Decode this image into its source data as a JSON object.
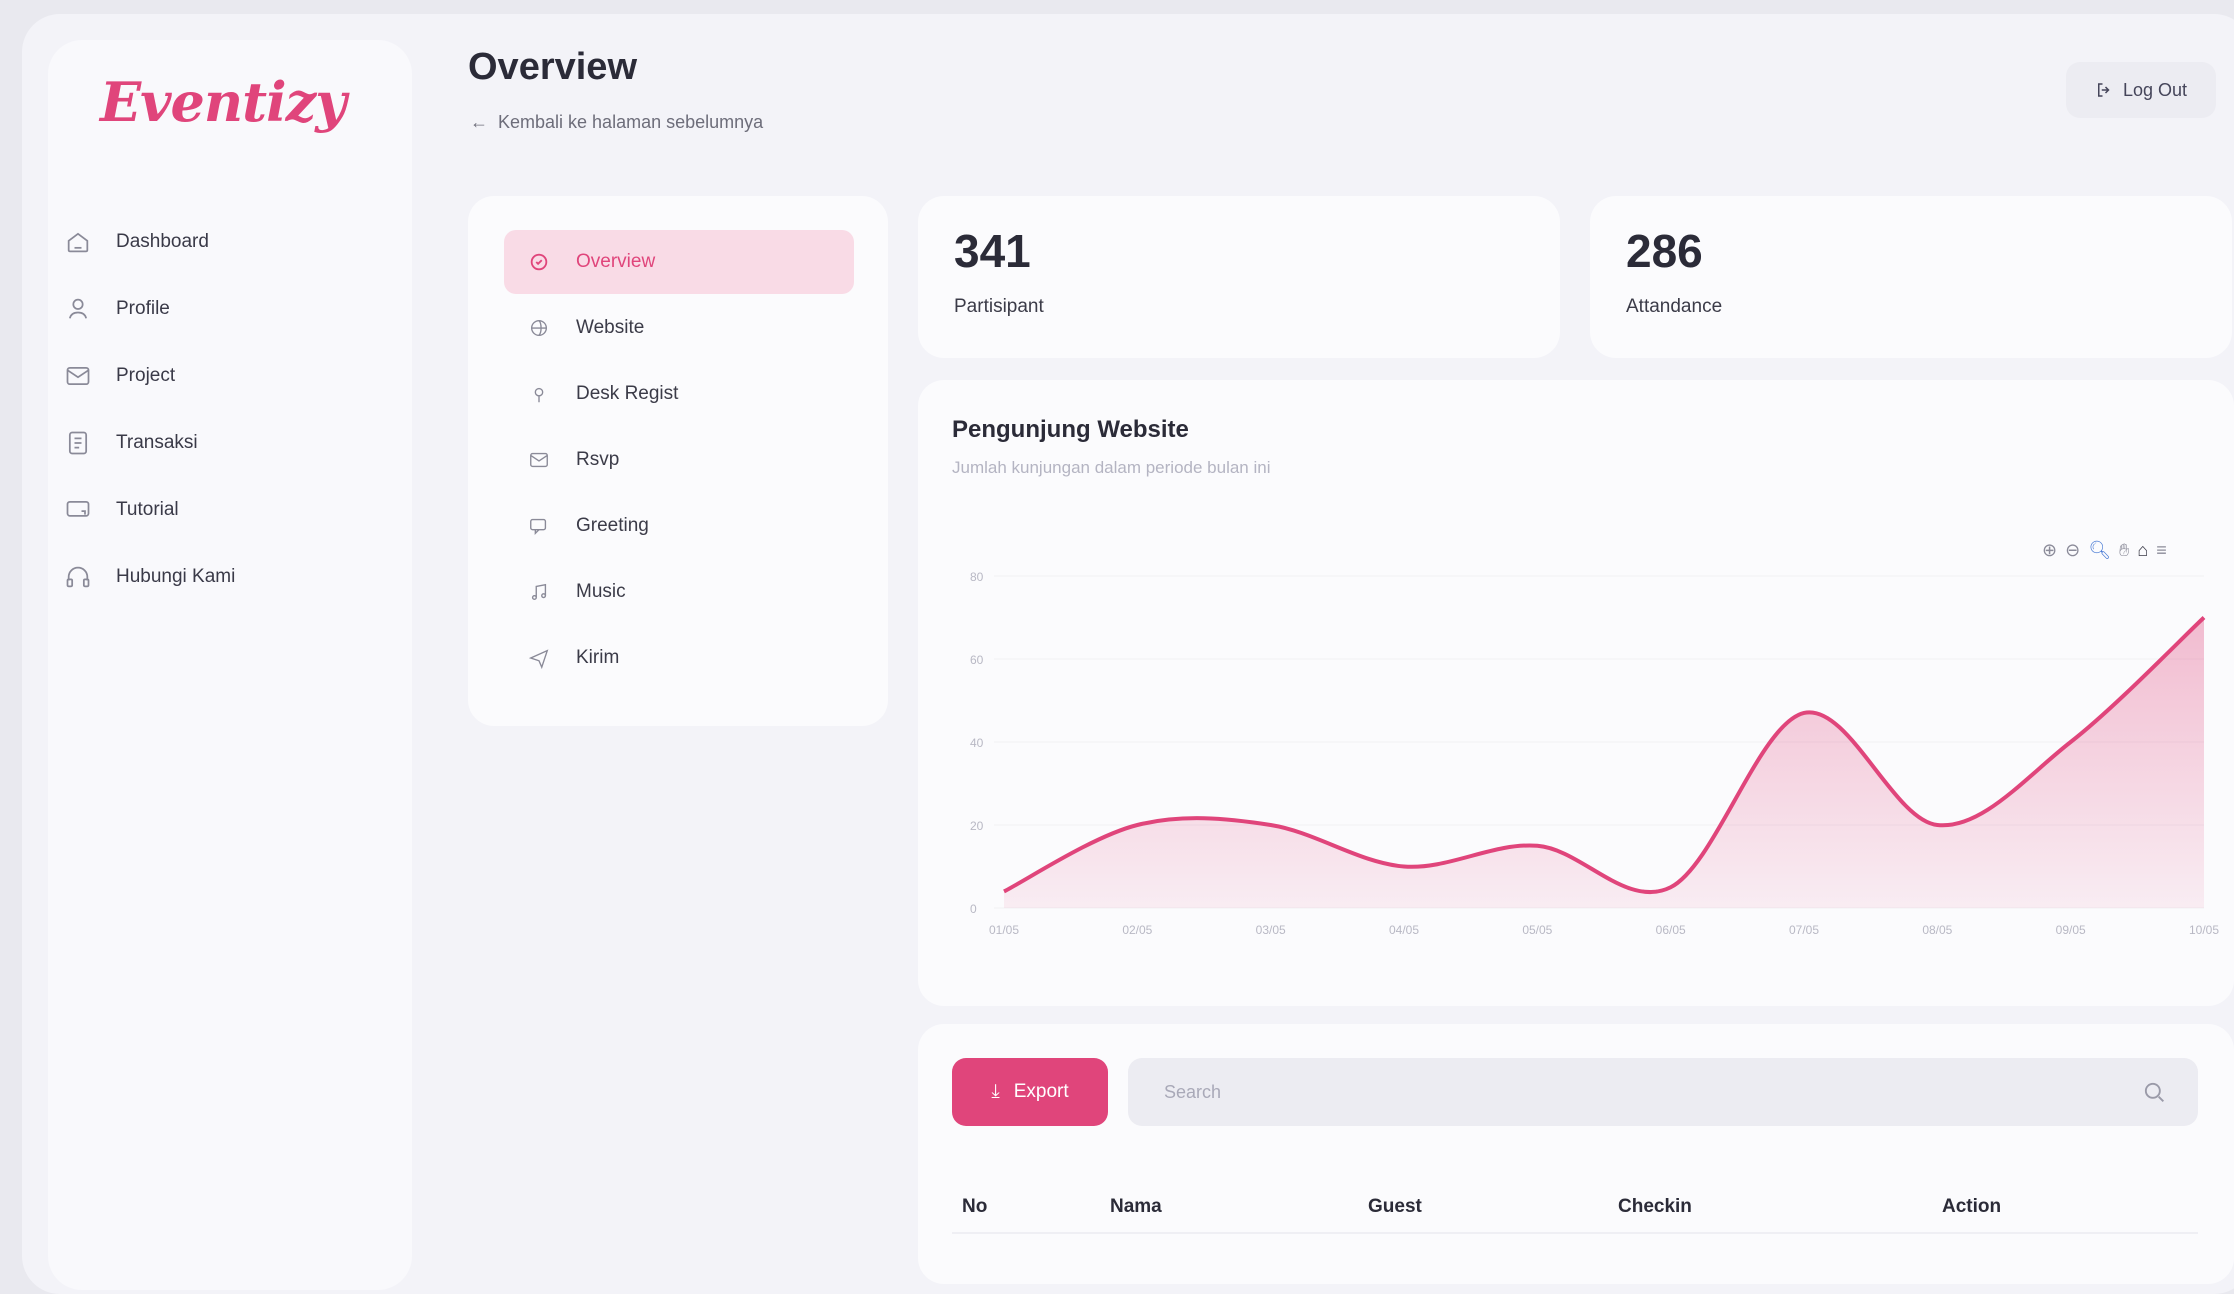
{
  "app": {
    "logo": "Eventizy",
    "accent": "#e0457b"
  },
  "sidebar": {
    "items": [
      {
        "label": "Dashboard",
        "icon": "home-icon"
      },
      {
        "label": "Profile",
        "icon": "user-icon"
      },
      {
        "label": "Project",
        "icon": "mail-icon"
      },
      {
        "label": "Transaksi",
        "icon": "receipt-icon"
      },
      {
        "label": "Tutorial",
        "icon": "monitor-icon"
      },
      {
        "label": "Hubungi Kami",
        "icon": "headset-icon"
      }
    ]
  },
  "header": {
    "title": "Overview",
    "back_link": "Kembali ke halaman sebelumnya",
    "logout_label": "Log Out"
  },
  "submenu": {
    "items": [
      {
        "label": "Overview",
        "icon": "overview-icon",
        "active": true
      },
      {
        "label": "Website",
        "icon": "globe-icon"
      },
      {
        "label": "Desk Regist",
        "icon": "pin-icon"
      },
      {
        "label": "Rsvp",
        "icon": "envelope-icon"
      },
      {
        "label": "Greeting",
        "icon": "chat-icon"
      },
      {
        "label": "Music",
        "icon": "music-icon"
      },
      {
        "label": "Kirim",
        "icon": "send-icon"
      }
    ]
  },
  "stats": [
    {
      "value": "341",
      "label": "Partisipant"
    },
    {
      "value": "286",
      "label": "Attandance"
    }
  ],
  "visitor_chart": {
    "title": "Pengunjung Website",
    "subtitle": "Jumlah kunjungan dalam periode bulan ini"
  },
  "chart_data": {
    "type": "area",
    "x": [
      "01/05",
      "02/05",
      "03/05",
      "04/05",
      "05/05",
      "06/05",
      "07/05",
      "08/05",
      "09/05",
      "10/05"
    ],
    "series": [
      {
        "values": [
          4,
          20,
          20,
          10,
          15,
          5,
          47,
          20,
          40,
          70
        ]
      }
    ],
    "y_ticks": [
      0,
      20,
      40,
      60,
      80
    ],
    "ylim": [
      0,
      80
    ],
    "grid": true,
    "color": "#e0457b",
    "fill": "gradient"
  },
  "table": {
    "export_label": "Export",
    "search_placeholder": "Search",
    "columns": [
      "No",
      "Nama",
      "Guest",
      "Checkin",
      "Action"
    ]
  }
}
